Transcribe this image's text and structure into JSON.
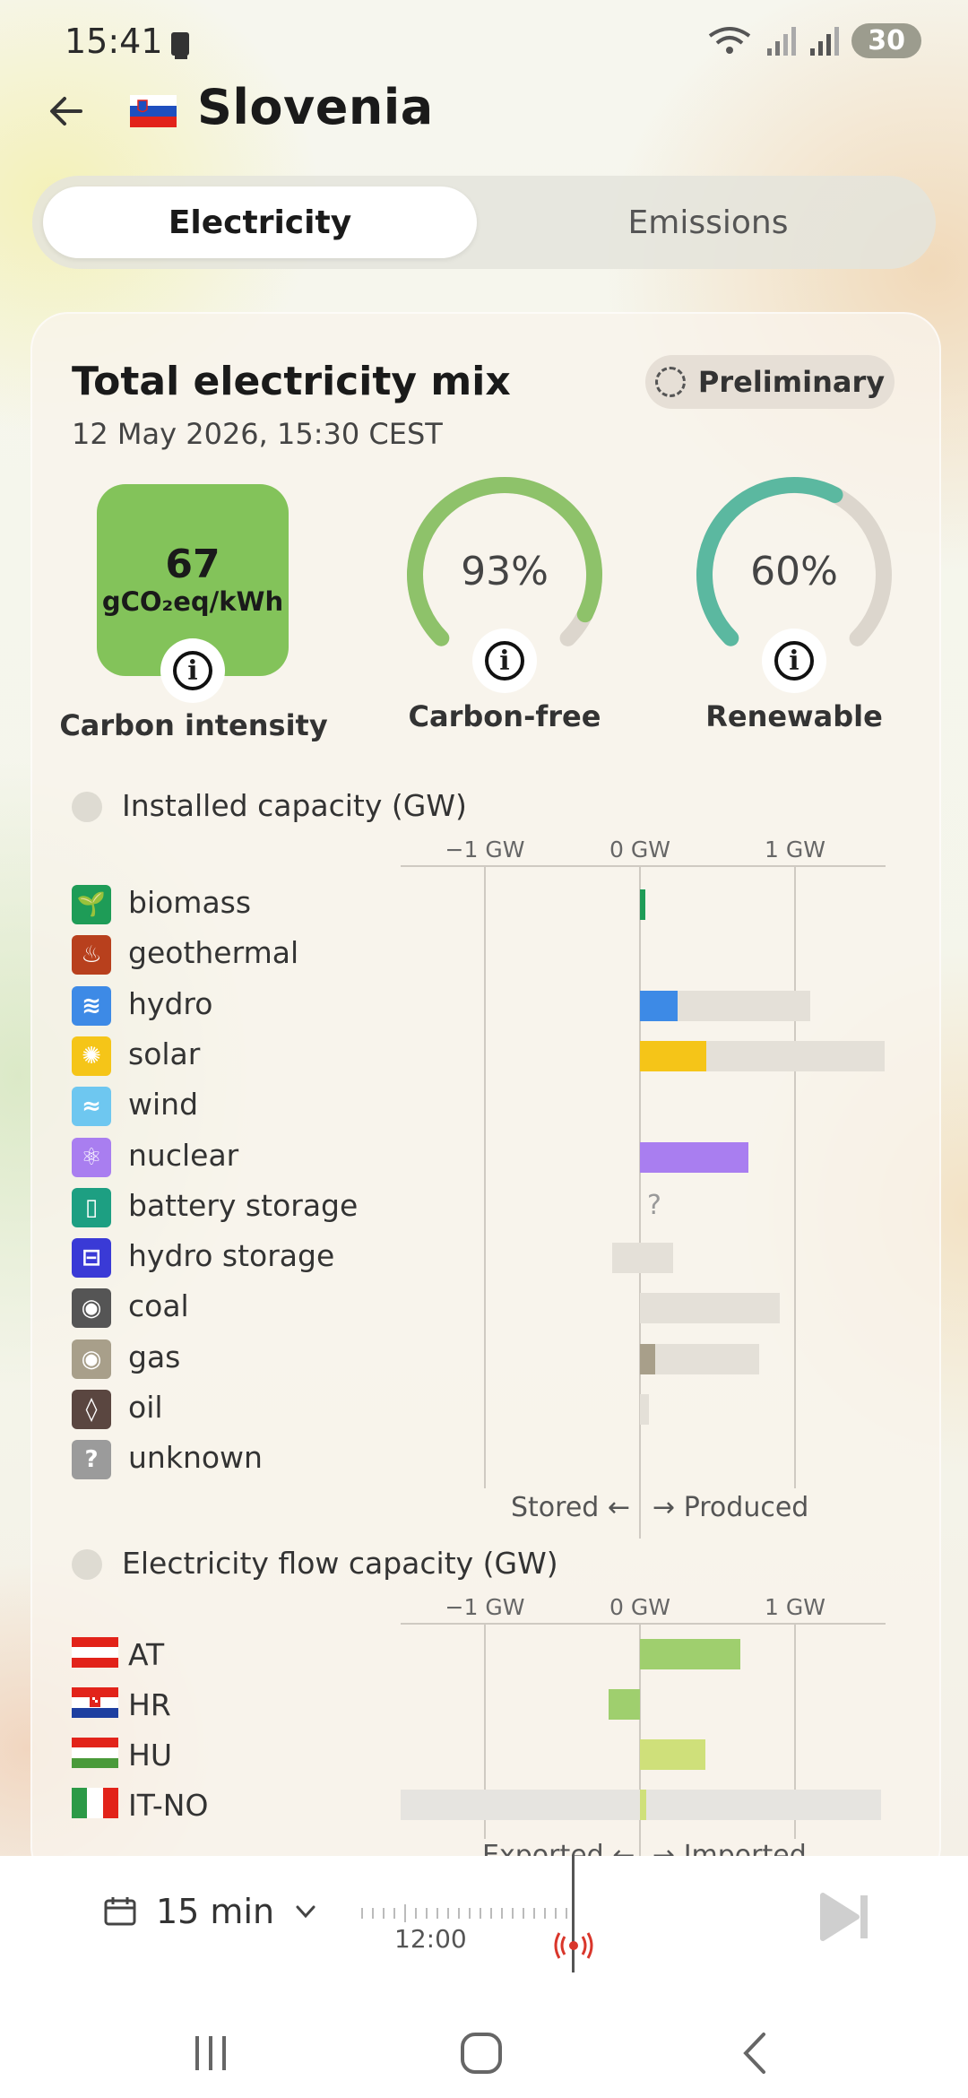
{
  "status": {
    "time": "15:41",
    "battery": "30"
  },
  "header": {
    "title": "Slovenia"
  },
  "tabs": [
    {
      "label": "Electricity",
      "active": true
    },
    {
      "label": "Emissions",
      "active": false
    }
  ],
  "card": {
    "title": "Total electricity mix",
    "subtitle": "12 May 2026, 15:30 CEST",
    "badge": "Preliminary"
  },
  "kpis": {
    "carbon_intensity": {
      "value": "67",
      "unit": "gCO₂eq/kWh",
      "label": "Carbon intensity",
      "color": "#83c35a"
    },
    "carbon_free": {
      "value": "93%",
      "label": "Carbon-free",
      "fraction": 0.93,
      "color": "#8ec26a"
    },
    "renewable": {
      "value": "60%",
      "label": "Renewable",
      "fraction": 0.6,
      "color": "#5bb8a0"
    }
  },
  "installed": {
    "title": "Installed capacity (GW)",
    "axis": [
      "−1 GW",
      "0 GW",
      "1 GW"
    ],
    "footer_left": "Stored",
    "footer_right": "Produced",
    "rows": [
      {
        "name": "biomass",
        "color": "#1e9c57",
        "symbol": "🌱",
        "cap": 0.03,
        "prod": 0.03
      },
      {
        "name": "geothermal",
        "color": "#b8401d",
        "symbol": "♨",
        "cap": 0,
        "prod": 0
      },
      {
        "name": "hydro",
        "color": "#3d8ae6",
        "symbol": "≋",
        "cap": 1.1,
        "prod": 0.24
      },
      {
        "name": "solar",
        "color": "#f5c518",
        "symbol": "✺",
        "cap": 1.58,
        "prod": 0.43
      },
      {
        "name": "wind",
        "color": "#6ec7f0",
        "symbol": "≈",
        "cap": 0,
        "prod": 0
      },
      {
        "name": "nuclear",
        "color": "#a97ef0",
        "symbol": "⚛",
        "cap": 0.7,
        "prod": 0.7
      },
      {
        "name": "battery storage",
        "color": "#1d9f82",
        "symbol": "▯",
        "cap": null,
        "prod": null,
        "unknown_mark": "?"
      },
      {
        "name": "hydro storage",
        "color": "#3a3ad6",
        "symbol": "⊟",
        "cap": 0.18,
        "prod": 0,
        "stored": 0.18
      },
      {
        "name": "coal",
        "color": "#555555",
        "symbol": "◉",
        "cap": 0.9,
        "prod": 0
      },
      {
        "name": "gas",
        "color": "#a89f8a",
        "symbol": "◉",
        "cap": 0.77,
        "prod": 0.1
      },
      {
        "name": "oil",
        "color": "#5a4640",
        "symbol": "◊",
        "cap": 0.06,
        "prod": 0
      },
      {
        "name": "unknown",
        "color": "#9b9b9b",
        "symbol": "?",
        "cap": 0,
        "prod": 0
      }
    ]
  },
  "flows": {
    "title": "Electricity flow capacity (GW)",
    "axis": [
      "−1 GW",
      "0 GW",
      "1 GW"
    ],
    "footer_left": "Exported",
    "footer_right": "Imported",
    "rows": [
      {
        "code": "AT",
        "value": 0.65,
        "color": "#9fcf6e"
      },
      {
        "code": "HR",
        "value": -0.2,
        "color": "#9fcf6e"
      },
      {
        "code": "HU",
        "value": 0.42,
        "color": "#cfe07a"
      },
      {
        "code": "IT-NO",
        "value": 0.04,
        "color": "#cfe07a",
        "range": [
          -1.55,
          1.55
        ]
      }
    ]
  },
  "bottom": {
    "interval": "15 min",
    "tick_label": "12:00"
  }
}
